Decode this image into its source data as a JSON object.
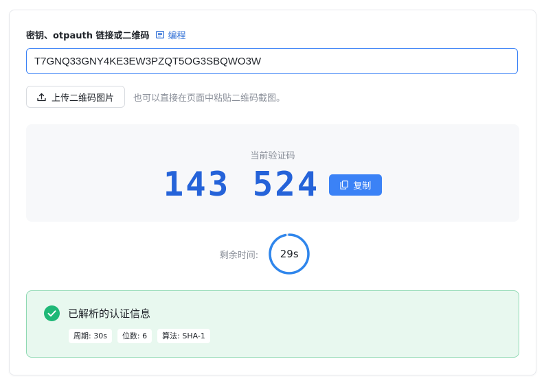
{
  "form": {
    "label": "密钥、otpauth 链接或二维码",
    "help_link": "编程",
    "secret_value": "T7GNQ33GNY4KE3EW3PZQT5OG3SBQWO3W",
    "upload_button": "上传二维码图片",
    "hint": "也可以直接在页面中粘贴二维码截图。"
  },
  "code": {
    "caption": "当前验证码",
    "value": "143 524",
    "copy_label": "复制"
  },
  "timer": {
    "label": "剩余时间:",
    "display": "29s",
    "remaining_fraction": 0.9667,
    "ring_color": "#2f86ec"
  },
  "info": {
    "title": "已解析的认证信息",
    "tags": [
      "周期: 30s",
      "位数: 6",
      "算法: SHA-1"
    ],
    "accent_color": "#1fb877"
  },
  "icons": {
    "help": "book-icon",
    "upload": "upload-icon",
    "copy": "copy-icon",
    "success": "check-circle-icon"
  },
  "colors": {
    "primary": "#3b82f6",
    "code_text": "#2563d9",
    "success_bg": "#e8f8ef",
    "success_border": "#8fd9b3"
  }
}
